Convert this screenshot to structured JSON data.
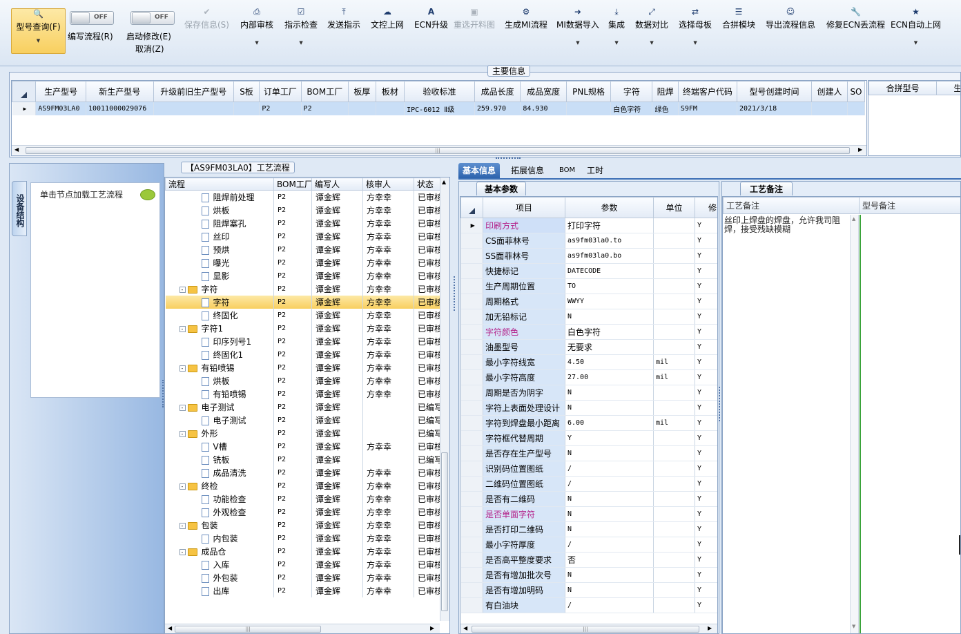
{
  "toolbar": {
    "query": {
      "label": "型号查询(F)",
      "icon": "search-icon"
    },
    "write_flow": {
      "label": "编写流程(R)",
      "toggle": "OFF"
    },
    "start_edit": {
      "label": "启动修改(E)",
      "label2": "取消(Z)",
      "toggle": "OFF"
    },
    "items": [
      {
        "label": "保存信息(S)",
        "icon": "save-icon",
        "disabled": true
      },
      {
        "label": "内部审核",
        "icon": "print-icon"
      },
      {
        "label": "指示检查",
        "icon": "check-icon"
      },
      {
        "label": "发送指示",
        "icon": "upload-icon"
      },
      {
        "label": "文控上网",
        "icon": "cloud-upload-icon"
      },
      {
        "label": "ECN升级",
        "icon": "ecn-icon"
      },
      {
        "label": "重选开料图",
        "icon": "image-icon",
        "disabled": true
      },
      {
        "label": "生成MI流程",
        "icon": "gears-icon"
      },
      {
        "label": "MI数据导入",
        "icon": "import-icon"
      },
      {
        "label": "集成",
        "icon": "download-icon"
      },
      {
        "label": "数据对比",
        "icon": "compare-icon"
      },
      {
        "label": "选择母板",
        "icon": "shuffle-icon"
      },
      {
        "label": "合拼模块",
        "icon": "list-icon"
      },
      {
        "label": "导出流程信息",
        "icon": "smile-icon"
      },
      {
        "label": "修复ECN丢流程",
        "icon": "wrench-icon"
      },
      {
        "label": "ECN自动上网",
        "icon": "star-icon"
      }
    ]
  },
  "main_info": {
    "title": "主要信息",
    "columns": [
      "生产型号",
      "新生产型号",
      "升级前旧生产型号",
      "S板",
      "订单工厂",
      "BOM工厂",
      "板厚",
      "板材",
      "验收标准",
      "成品长度",
      "成品宽度",
      "PNL规格",
      "字符",
      "阻焊",
      "终端客户代码",
      "型号创建时间",
      "创建人",
      "SO"
    ],
    "row": [
      "AS9FM03LA0",
      "10011000029076",
      "",
      "",
      "P2",
      "P2",
      "",
      "",
      "IPC-6012 Ⅱ级",
      "259.970",
      "84.930",
      "",
      "白色字符",
      "绿色",
      "S9FM",
      "2021/3/18",
      "",
      ""
    ],
    "merge_columns": [
      "合拼型号",
      "生"
    ]
  },
  "left": {
    "vtab": "设备结构",
    "hint": "单击节点加载工艺流程"
  },
  "flow": {
    "title": "【AS9FM03LA0】工艺流程",
    "columns": [
      "流程",
      "BOM工厂",
      "编写人",
      "核审人",
      "状态"
    ],
    "rows": [
      {
        "indent": 2,
        "type": "doc",
        "name": "阻焊前处理",
        "bom": "P2",
        "writer": "谭金辉",
        "reviewer": "方幸幸",
        "status": "已审核"
      },
      {
        "indent": 2,
        "type": "doc",
        "name": "烘板",
        "bom": "P2",
        "writer": "谭金辉",
        "reviewer": "方幸幸",
        "status": "已审核"
      },
      {
        "indent": 2,
        "type": "doc",
        "name": "阻焊塞孔",
        "bom": "P2",
        "writer": "谭金辉",
        "reviewer": "方幸幸",
        "status": "已审核"
      },
      {
        "indent": 2,
        "type": "doc",
        "name": "丝印",
        "bom": "P2",
        "writer": "谭金辉",
        "reviewer": "方幸幸",
        "status": "已审核"
      },
      {
        "indent": 2,
        "type": "doc",
        "name": "预烘",
        "bom": "P2",
        "writer": "谭金辉",
        "reviewer": "方幸幸",
        "status": "已审核"
      },
      {
        "indent": 2,
        "type": "doc",
        "name": "曝光",
        "bom": "P2",
        "writer": "谭金辉",
        "reviewer": "方幸幸",
        "status": "已审核"
      },
      {
        "indent": 2,
        "type": "doc",
        "name": "显影",
        "bom": "P2",
        "writer": "谭金辉",
        "reviewer": "方幸幸",
        "status": "已审核"
      },
      {
        "indent": 1,
        "type": "folder",
        "name": "字符",
        "bom": "P2",
        "writer": "谭金辉",
        "reviewer": "方幸幸",
        "status": "已审核"
      },
      {
        "indent": 2,
        "type": "doc",
        "name": "字符",
        "bom": "P2",
        "writer": "谭金辉",
        "reviewer": "方幸幸",
        "status": "已审核",
        "selected": true
      },
      {
        "indent": 2,
        "type": "doc",
        "name": "终固化",
        "bom": "P2",
        "writer": "谭金辉",
        "reviewer": "方幸幸",
        "status": "已审核"
      },
      {
        "indent": 1,
        "type": "folder",
        "name": "字符1",
        "bom": "P2",
        "writer": "谭金辉",
        "reviewer": "方幸幸",
        "status": "已审核"
      },
      {
        "indent": 2,
        "type": "doc",
        "name": "印序列号1",
        "bom": "P2",
        "writer": "谭金辉",
        "reviewer": "方幸幸",
        "status": "已审核"
      },
      {
        "indent": 2,
        "type": "doc",
        "name": "终固化1",
        "bom": "P2",
        "writer": "谭金辉",
        "reviewer": "方幸幸",
        "status": "已审核"
      },
      {
        "indent": 1,
        "type": "folder",
        "name": "有铅喷锡",
        "bom": "P2",
        "writer": "谭金辉",
        "reviewer": "方幸幸",
        "status": "已审核"
      },
      {
        "indent": 2,
        "type": "doc",
        "name": "烘板",
        "bom": "P2",
        "writer": "谭金辉",
        "reviewer": "方幸幸",
        "status": "已审核"
      },
      {
        "indent": 2,
        "type": "doc",
        "name": "有铅喷锡",
        "bom": "P2",
        "writer": "谭金辉",
        "reviewer": "方幸幸",
        "status": "已审核"
      },
      {
        "indent": 1,
        "type": "folder",
        "name": "电子测试",
        "bom": "P2",
        "writer": "谭金辉",
        "reviewer": "",
        "status": "已编写"
      },
      {
        "indent": 2,
        "type": "doc",
        "name": "电子测试",
        "bom": "P2",
        "writer": "谭金辉",
        "reviewer": "",
        "status": "已编写"
      },
      {
        "indent": 1,
        "type": "folder",
        "name": "外形",
        "bom": "P2",
        "writer": "谭金辉",
        "reviewer": "",
        "status": "已编写"
      },
      {
        "indent": 2,
        "type": "doc",
        "name": "V槽",
        "bom": "P2",
        "writer": "谭金辉",
        "reviewer": "方幸幸",
        "status": "已审核"
      },
      {
        "indent": 2,
        "type": "doc",
        "name": "铣板",
        "bom": "P2",
        "writer": "谭金辉",
        "reviewer": "",
        "status": "已编写"
      },
      {
        "indent": 2,
        "type": "doc",
        "name": "成品清洗",
        "bom": "P2",
        "writer": "谭金辉",
        "reviewer": "方幸幸",
        "status": "已审核"
      },
      {
        "indent": 1,
        "type": "folder",
        "name": "终检",
        "bom": "P2",
        "writer": "谭金辉",
        "reviewer": "方幸幸",
        "status": "已审核"
      },
      {
        "indent": 2,
        "type": "doc",
        "name": "功能检查",
        "bom": "P2",
        "writer": "谭金辉",
        "reviewer": "方幸幸",
        "status": "已审核"
      },
      {
        "indent": 2,
        "type": "doc",
        "name": "外观检查",
        "bom": "P2",
        "writer": "谭金辉",
        "reviewer": "方幸幸",
        "status": "已审核"
      },
      {
        "indent": 1,
        "type": "folder",
        "name": "包装",
        "bom": "P2",
        "writer": "谭金辉",
        "reviewer": "方幸幸",
        "status": "已审核"
      },
      {
        "indent": 2,
        "type": "doc",
        "name": "内包装",
        "bom": "P2",
        "writer": "谭金辉",
        "reviewer": "方幸幸",
        "status": "已审核"
      },
      {
        "indent": 1,
        "type": "folder",
        "name": "成品仓",
        "bom": "P2",
        "writer": "谭金辉",
        "reviewer": "方幸幸",
        "status": "已审核"
      },
      {
        "indent": 2,
        "type": "doc",
        "name": "入库",
        "bom": "P2",
        "writer": "谭金辉",
        "reviewer": "方幸幸",
        "status": "已审核"
      },
      {
        "indent": 2,
        "type": "doc",
        "name": "外包装",
        "bom": "P2",
        "writer": "谭金辉",
        "reviewer": "方幸幸",
        "status": "已审核"
      },
      {
        "indent": 2,
        "type": "doc",
        "name": "出库",
        "bom": "P2",
        "writer": "谭金辉",
        "reviewer": "方幸幸",
        "status": "已审核"
      }
    ]
  },
  "right_tabs": [
    "基本信息",
    "拓展信息",
    "BOM",
    "工时"
  ],
  "params": {
    "tab": "基本参数",
    "columns": [
      "项目",
      "参数",
      "单位",
      "修"
    ],
    "rows": [
      {
        "k": "印刷方式",
        "v": "打印字符",
        "u": "",
        "f": "Y",
        "pink": true,
        "current": true
      },
      {
        "k": "CS面菲林号",
        "v": "as9fm03la0.to",
        "u": "",
        "f": "Y"
      },
      {
        "k": "SS面菲林号",
        "v": "as9fm03la0.bo",
        "u": "",
        "f": "Y"
      },
      {
        "k": "快捷标记",
        "v": "DATECODE",
        "u": "",
        "f": "Y"
      },
      {
        "k": "生产周期位置",
        "v": "TO",
        "u": "",
        "f": "Y"
      },
      {
        "k": "周期格式",
        "v": "WWYY",
        "u": "",
        "f": "Y"
      },
      {
        "k": "加无铅标记",
        "v": "N",
        "u": "",
        "f": "Y"
      },
      {
        "k": "字符颜色",
        "v": "白色字符",
        "u": "",
        "f": "Y",
        "pink": true
      },
      {
        "k": "油墨型号",
        "v": "无要求",
        "u": "",
        "f": "Y"
      },
      {
        "k": "最小字符线宽",
        "v": "4.50",
        "u": "mil",
        "f": "Y"
      },
      {
        "k": "最小字符高度",
        "v": "27.00",
        "u": "mil",
        "f": "Y"
      },
      {
        "k": "周期是否为阴字",
        "v": "N",
        "u": "",
        "f": "Y"
      },
      {
        "k": "字符上表面处理设计",
        "v": "N",
        "u": "",
        "f": "Y"
      },
      {
        "k": "字符到焊盘最小距离",
        "v": "6.00",
        "u": "mil",
        "f": "Y"
      },
      {
        "k": "字符框代替周期",
        "v": "Y",
        "u": "",
        "f": "Y"
      },
      {
        "k": "是否存在生产型号",
        "v": "N",
        "u": "",
        "f": "Y"
      },
      {
        "k": "识别码位置图纸",
        "v": "/",
        "u": "",
        "f": "Y"
      },
      {
        "k": "二维码位置图纸",
        "v": "/",
        "u": "",
        "f": "Y"
      },
      {
        "k": "是否有二维码",
        "v": "N",
        "u": "",
        "f": "Y"
      },
      {
        "k": "是否单面字符",
        "v": "N",
        "u": "",
        "f": "Y",
        "pink": true
      },
      {
        "k": "是否打印二维码",
        "v": "N",
        "u": "",
        "f": "Y"
      },
      {
        "k": "最小字符厚度",
        "v": "/",
        "u": "",
        "f": "Y"
      },
      {
        "k": "是否高平整度要求",
        "v": "否",
        "u": "",
        "f": "Y"
      },
      {
        "k": "是否有增加批次号",
        "v": "N",
        "u": "",
        "f": "Y"
      },
      {
        "k": "是否有增加明码",
        "v": "N",
        "u": "",
        "f": "Y"
      },
      {
        "k": "有白油块",
        "v": "/",
        "u": "",
        "f": "Y"
      }
    ]
  },
  "remarks": {
    "tab": "工艺备注",
    "col1": "工艺备注",
    "col2": "型号备注",
    "text": "丝印上焊盘的焊盘，允许我司阻焊，接受残缺模糊"
  }
}
